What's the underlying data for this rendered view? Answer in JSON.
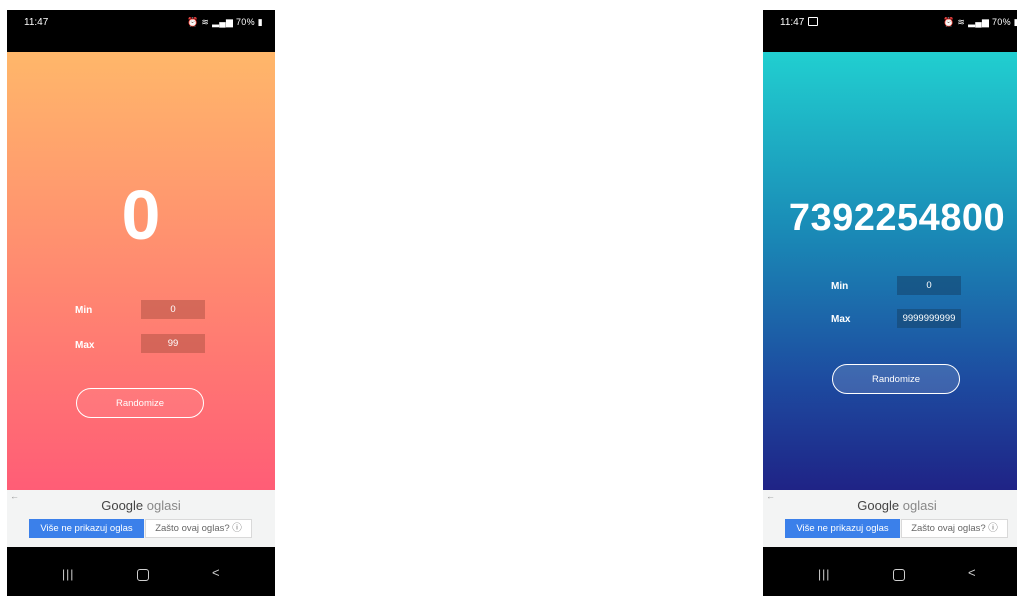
{
  "screens": [
    {
      "status": {
        "time": "11:47",
        "battery": "70%"
      },
      "result": "0",
      "min": {
        "label": "Min",
        "value": "0"
      },
      "max": {
        "label": "Max",
        "value": "99"
      },
      "randomize_label": "Randomize",
      "ad": {
        "brand": "Google",
        "brand_suffix": "oglasi",
        "stop_label": "Više ne prikazuj oglas",
        "why_label": "Zašto ovaj oglas? ⓘ"
      },
      "colors": {
        "gradient_top": "#ffb76a",
        "gradient_bottom": "#ff5d76"
      }
    },
    {
      "status": {
        "time": "11:47",
        "battery": "70%"
      },
      "result": "7392254800",
      "min": {
        "label": "Min",
        "value": "0"
      },
      "max": {
        "label": "Max",
        "value": "9999999999"
      },
      "randomize_label": "Randomize",
      "ad": {
        "brand": "Google",
        "brand_suffix": "oglasi",
        "stop_label": "Više ne prikazuj oglas",
        "why_label": "Zašto ovaj oglas? ⓘ"
      },
      "colors": {
        "gradient_top": "#21cfd0",
        "gradient_bottom": "#1f2386"
      }
    }
  ],
  "icons": [
    "alarm-icon",
    "wifi-icon",
    "signal-icon",
    "battery-icon",
    "image-notification-icon",
    "recents-icon",
    "home-icon",
    "back-icon",
    "ad-back-arrow-icon"
  ]
}
